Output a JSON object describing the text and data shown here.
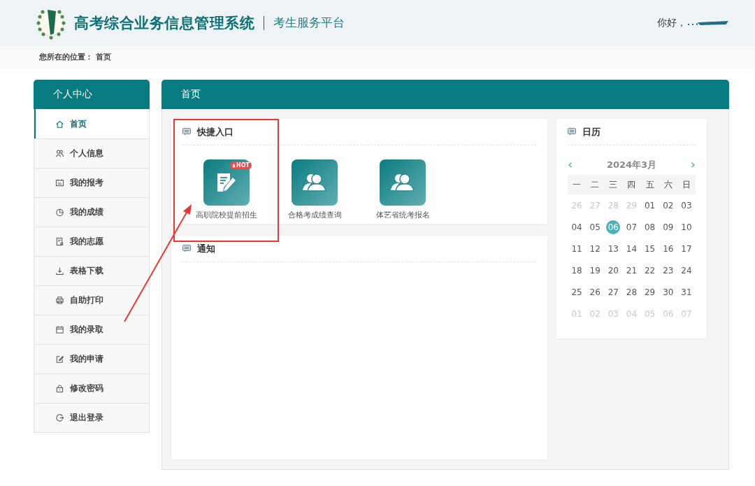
{
  "header": {
    "title": "高考综合业务信息管理系统",
    "subtitle": "考生服务平台",
    "greeting": "你好，"
  },
  "breadcrumb": {
    "label": "您所在的位置：",
    "current": "首页"
  },
  "sidebar": {
    "title": "个人中心",
    "items": [
      {
        "label": "首页",
        "selected": true
      },
      {
        "label": "个人信息",
        "selected": false
      },
      {
        "label": "我的报考",
        "selected": false
      },
      {
        "label": "我的成绩",
        "selected": false
      },
      {
        "label": "我的志愿",
        "selected": false
      },
      {
        "label": "表格下载",
        "selected": false
      },
      {
        "label": "自助打印",
        "selected": false
      },
      {
        "label": "我的录取",
        "selected": false
      },
      {
        "label": "我的申请",
        "selected": false
      },
      {
        "label": "修改密码",
        "selected": false
      },
      {
        "label": "退出登录",
        "selected": false
      }
    ]
  },
  "main": {
    "title": "首页"
  },
  "shortcuts": {
    "title": "快捷入口",
    "items": [
      {
        "label": "高职院校提前招生",
        "kind": "document",
        "badge": "HOT"
      },
      {
        "label": "合格考成绩查询",
        "kind": "people"
      },
      {
        "label": "体艺省统考报名",
        "kind": "people"
      }
    ]
  },
  "notices": {
    "title": "通知"
  },
  "calendar": {
    "title": "日历",
    "month": "2024年3月",
    "prev": "‹",
    "next": "›",
    "weekdays": [
      "一",
      "二",
      "三",
      "四",
      "五",
      "六",
      "日"
    ],
    "days": [
      {
        "day": "26",
        "muted": true,
        "selected": false
      },
      {
        "day": "27",
        "muted": true,
        "selected": false
      },
      {
        "day": "28",
        "muted": true,
        "selected": false
      },
      {
        "day": "29",
        "muted": true,
        "selected": false
      },
      {
        "day": "01",
        "muted": false,
        "selected": false
      },
      {
        "day": "02",
        "muted": false,
        "selected": false
      },
      {
        "day": "03",
        "muted": false,
        "selected": false
      },
      {
        "day": "04",
        "muted": false,
        "selected": false
      },
      {
        "day": "05",
        "muted": false,
        "selected": false
      },
      {
        "day": "06",
        "muted": false,
        "selected": true
      },
      {
        "day": "07",
        "muted": false,
        "selected": false
      },
      {
        "day": "08",
        "muted": false,
        "selected": false
      },
      {
        "day": "09",
        "muted": false,
        "selected": false
      },
      {
        "day": "10",
        "muted": false,
        "selected": false
      },
      {
        "day": "11",
        "muted": false,
        "selected": false
      },
      {
        "day": "12",
        "muted": false,
        "selected": false
      },
      {
        "day": "13",
        "muted": false,
        "selected": false
      },
      {
        "day": "14",
        "muted": false,
        "selected": false
      },
      {
        "day": "15",
        "muted": false,
        "selected": false
      },
      {
        "day": "16",
        "muted": false,
        "selected": false
      },
      {
        "day": "17",
        "muted": false,
        "selected": false
      },
      {
        "day": "18",
        "muted": false,
        "selected": false
      },
      {
        "day": "19",
        "muted": false,
        "selected": false
      },
      {
        "day": "20",
        "muted": false,
        "selected": false
      },
      {
        "day": "21",
        "muted": false,
        "selected": false
      },
      {
        "day": "22",
        "muted": false,
        "selected": false
      },
      {
        "day": "23",
        "muted": false,
        "selected": false
      },
      {
        "day": "24",
        "muted": false,
        "selected": false
      },
      {
        "day": "25",
        "muted": false,
        "selected": false
      },
      {
        "day": "26",
        "muted": false,
        "selected": false
      },
      {
        "day": "27",
        "muted": false,
        "selected": false
      },
      {
        "day": "28",
        "muted": false,
        "selected": false
      },
      {
        "day": "29",
        "muted": false,
        "selected": false
      },
      {
        "day": "30",
        "muted": false,
        "selected": false
      },
      {
        "day": "31",
        "muted": false,
        "selected": false
      },
      {
        "day": "01",
        "muted": true,
        "selected": false
      },
      {
        "day": "02",
        "muted": true,
        "selected": false
      },
      {
        "day": "03",
        "muted": true,
        "selected": false
      },
      {
        "day": "04",
        "muted": true,
        "selected": false
      },
      {
        "day": "05",
        "muted": true,
        "selected": false
      },
      {
        "day": "06",
        "muted": true,
        "selected": false
      },
      {
        "day": "07",
        "muted": true,
        "selected": false
      }
    ]
  }
}
